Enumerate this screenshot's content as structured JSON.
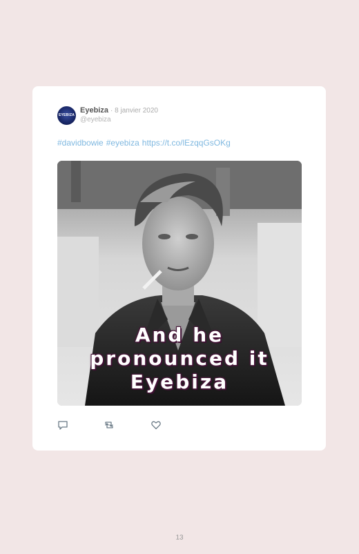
{
  "tweet": {
    "avatar_text": "EYEBIZA",
    "display_name": "Eyebiza",
    "date": "· 8 janvier 2020",
    "handle": "@eyebiza",
    "hashtags": [
      "#davidbowie",
      "#eyebiza"
    ],
    "link": "https://t.co/lEzqqGsOKg",
    "media_caption": [
      "And he",
      "pronounced it",
      "Eyebiza"
    ]
  },
  "actions": {
    "reply_icon": "reply-icon",
    "retweet_icon": "retweet-icon",
    "like_icon": "heart-icon"
  },
  "page": {
    "number": "13"
  },
  "colors": {
    "background": "#f2e6e6",
    "card": "#ffffff",
    "link": "#7fb8e0",
    "caption_outline": "#3a1030"
  }
}
